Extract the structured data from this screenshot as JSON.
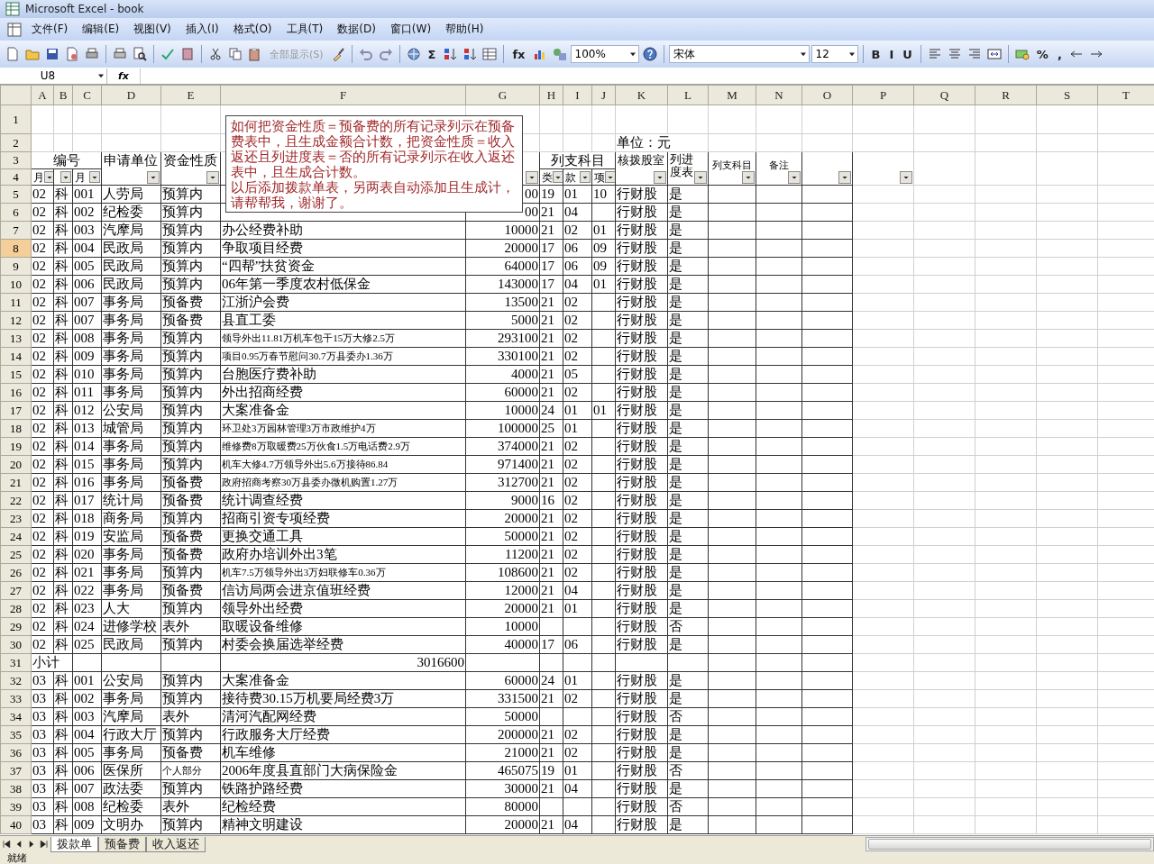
{
  "window": {
    "title": "Microsoft Excel - book"
  },
  "menu": [
    "文件(F)",
    "编辑(E)",
    "视图(V)",
    "插入(I)",
    "格式(O)",
    "工具(T)",
    "数据(D)",
    "窗口(W)",
    "帮助(H)"
  ],
  "toolbar": [
    {
      "kind": "icon"
    },
    {
      "kind": "icon"
    },
    {
      "kind": "icon"
    },
    {
      "kind": "icon"
    },
    {
      "kind": "icon"
    },
    {
      "kind": "sep"
    },
    {
      "kind": "icon"
    },
    {
      "kind": "icon"
    },
    {
      "kind": "sep"
    },
    {
      "kind": "icon"
    },
    {
      "kind": "icon"
    },
    {
      "kind": "sep"
    },
    {
      "kind": "icon"
    },
    {
      "kind": "icon"
    },
    {
      "kind": "icon"
    },
    {
      "kind": "text",
      "label": "全部显示(S)",
      "disabled": true
    },
    {
      "kind": "icon"
    },
    {
      "kind": "sep"
    },
    {
      "kind": "icon"
    },
    {
      "kind": "icon"
    },
    {
      "kind": "sep"
    },
    {
      "kind": "icon"
    },
    {
      "kind": "text",
      "label": "Σ",
      "disabled": false
    },
    {
      "kind": "icon"
    },
    {
      "kind": "icon"
    },
    {
      "kind": "icon"
    },
    {
      "kind": "sep"
    },
    {
      "kind": "text",
      "label": "fx",
      "disabled": false
    },
    {
      "kind": "icon"
    },
    {
      "kind": "icon"
    },
    {
      "kind": "combo",
      "value": "100%"
    },
    {
      "kind": "icon"
    },
    {
      "kind": "sep"
    },
    {
      "kind": "combo",
      "value": "宋体"
    },
    {
      "kind": "combo",
      "value": "12"
    },
    {
      "kind": "sep"
    },
    {
      "kind": "text",
      "label": "B",
      "disabled": false
    },
    {
      "kind": "text",
      "label": "I",
      "disabled": false
    },
    {
      "kind": "text",
      "label": "U",
      "disabled": false
    },
    {
      "kind": "sep"
    },
    {
      "kind": "icon"
    },
    {
      "kind": "icon"
    },
    {
      "kind": "icon"
    },
    {
      "kind": "icon"
    },
    {
      "kind": "sep"
    },
    {
      "kind": "icon"
    },
    {
      "kind": "text",
      "label": "%",
      "disabled": false
    },
    {
      "kind": "text",
      "label": ",",
      "disabled": false
    },
    {
      "kind": "icon"
    },
    {
      "kind": "icon"
    }
  ],
  "formula_bar": {
    "name_box": "U8",
    "fx": "fx"
  },
  "columns": [
    "A",
    "B",
    "C",
    "D",
    "E",
    "F",
    "G",
    "H",
    "I",
    "J",
    "K",
    "L",
    "M",
    "N",
    "O",
    "P",
    "Q",
    "R",
    "S",
    "T"
  ],
  "top_rows": [
    {
      "n": "1",
      "selected": false
    },
    {
      "n": "2",
      "selected": false
    },
    {
      "n": "3",
      "selected": false
    },
    {
      "n": "4",
      "selected": false
    }
  ],
  "unit_note": "单位：元",
  "table_header": [
    {
      "label": "编号",
      "sub": [
        {
          "label": "月",
          "filter": true
        },
        {
          "filter": true
        },
        {
          "label": "月",
          "filter": true
        }
      ]
    },
    {
      "label": "申请单位",
      "filter": true
    },
    {
      "label": "资金性质",
      "filter": true
    },
    {
      "filter": false
    },
    {
      "filter": true
    },
    {
      "label": "列支科目",
      "sub": [
        {
          "label": "类",
          "filter": true
        },
        {
          "label": "款",
          "filter": true
        },
        {
          "label": "项",
          "filter": true
        }
      ]
    },
    {
      "label": "核拨股室",
      "filter": true
    },
    {
      "label": "列进度表",
      "filter": true
    },
    {
      "label": "列支科目",
      "filter": true,
      "small": true
    },
    {
      "label": "备注",
      "filter": true,
      "small": true
    },
    {
      "filter": true
    },
    {
      "filter": true,
      "outside": true
    }
  ],
  "rows": [
    {
      "n": "5",
      "selected": false,
      "cells": [
        "02",
        "科",
        "001",
        "人劳局",
        "预算内",
        "",
        "00",
        "19",
        "01",
        "10",
        "行财股",
        "是"
      ]
    },
    {
      "n": "6",
      "selected": false,
      "cells": [
        "02",
        "科",
        "002",
        "纪检委",
        "预算内",
        "",
        "00",
        "21",
        "04",
        "",
        "行财股",
        "是"
      ]
    },
    {
      "n": "7",
      "selected": false,
      "cells": [
        "02",
        "科",
        "003",
        "汽摩局",
        "预算内",
        "办公经费补助",
        "10000",
        "21",
        "02",
        "01",
        "行财股",
        "是"
      ]
    },
    {
      "n": "8",
      "selected": true,
      "cells": [
        "02",
        "科",
        "004",
        "民政局",
        "预算内",
        "争取项目经费",
        "20000",
        "17",
        "06",
        "09",
        "行财股",
        "是"
      ]
    },
    {
      "n": "9",
      "selected": false,
      "cells": [
        "02",
        "科",
        "005",
        "民政局",
        "预算内",
        "“四帮”扶贫资金",
        "64000",
        "17",
        "06",
        "09",
        "行财股",
        "是"
      ]
    },
    {
      "n": "10",
      "selected": false,
      "cells": [
        "02",
        "科",
        "006",
        "民政局",
        "预算内",
        "06年第一季度农村低保金",
        "143000",
        "17",
        "04",
        "01",
        "行财股",
        "是"
      ]
    },
    {
      "n": "11",
      "selected": false,
      "cells": [
        "02",
        "科",
        "007",
        "事务局",
        "预备费",
        "江浙沪会费",
        "13500",
        "21",
        "02",
        "",
        "行财股",
        "是"
      ]
    },
    {
      "n": "12",
      "selected": false,
      "cells": [
        "02",
        "科",
        "007",
        "事务局",
        "预备费",
        "县直工委",
        "5000",
        "21",
        "02",
        "",
        "行财股",
        "是"
      ]
    },
    {
      "n": "13",
      "selected": false,
      "small": {
        "F": true
      },
      "cells": [
        "02",
        "科",
        "008",
        "事务局",
        "预算内",
        "领导外出11.81万机车包干15万大修2.5万",
        "293100",
        "21",
        "02",
        "",
        "行财股",
        "是"
      ]
    },
    {
      "n": "14",
      "selected": false,
      "small": {
        "F": true
      },
      "cells": [
        "02",
        "科",
        "009",
        "事务局",
        "预算内",
        "项目0.95万春节慰问30.7万县委办1.36万",
        "330100",
        "21",
        "02",
        "",
        "行财股",
        "是"
      ]
    },
    {
      "n": "15",
      "selected": false,
      "cells": [
        "02",
        "科",
        "010",
        "事务局",
        "预算内",
        "台胞医疗费补助",
        "4000",
        "21",
        "05",
        "",
        "行财股",
        "是"
      ]
    },
    {
      "n": "16",
      "selected": false,
      "cells": [
        "02",
        "科",
        "011",
        "事务局",
        "预算内",
        "外出招商经费",
        "60000",
        "21",
        "02",
        "",
        "行财股",
        "是"
      ]
    },
    {
      "n": "17",
      "selected": false,
      "cells": [
        "02",
        "科",
        "012",
        "公安局",
        "预算内",
        "大案准备金",
        "10000",
        "24",
        "01",
        "01",
        "行财股",
        "是"
      ]
    },
    {
      "n": "18",
      "selected": false,
      "small": {
        "F": true
      },
      "cells": [
        "02",
        "科",
        "013",
        "城管局",
        "预算内",
        "环卫处3万园林管理3万市政维护4万",
        "100000",
        "25",
        "01",
        "",
        "行财股",
        "是"
      ]
    },
    {
      "n": "19",
      "selected": false,
      "small": {
        "F": true
      },
      "cells": [
        "02",
        "科",
        "014",
        "事务局",
        "预算内",
        "维修费8万取暖费25万伙食1.5万电话费2.9万",
        "374000",
        "21",
        "02",
        "",
        "行财股",
        "是"
      ]
    },
    {
      "n": "20",
      "selected": false,
      "small": {
        "F": true
      },
      "cells": [
        "02",
        "科",
        "015",
        "事务局",
        "预算内",
        "机车大修4.7万领导外出5.6万接待86.84",
        "971400",
        "21",
        "02",
        "",
        "行财股",
        "是"
      ]
    },
    {
      "n": "21",
      "selected": false,
      "small": {
        "F": true
      },
      "cells": [
        "02",
        "科",
        "016",
        "事务局",
        "预备费",
        "政府招商考察30万县委办微机购置1.27万",
        "312700",
        "21",
        "02",
        "",
        "行财股",
        "是"
      ]
    },
    {
      "n": "22",
      "selected": false,
      "cells": [
        "02",
        "科",
        "017",
        "统计局",
        "预备费",
        "统计调查经费",
        "9000",
        "16",
        "02",
        "",
        "行财股",
        "是"
      ]
    },
    {
      "n": "23",
      "selected": false,
      "cells": [
        "02",
        "科",
        "018",
        "商务局",
        "预算内",
        "招商引资专项经费",
        "20000",
        "21",
        "02",
        "",
        "行财股",
        "是"
      ]
    },
    {
      "n": "24",
      "selected": false,
      "cells": [
        "02",
        "科",
        "019",
        "安监局",
        "预备费",
        "更换交通工具",
        "50000",
        "21",
        "02",
        "",
        "行财股",
        "是"
      ]
    },
    {
      "n": "25",
      "selected": false,
      "cells": [
        "02",
        "科",
        "020",
        "事务局",
        "预备费",
        "政府办培训外出3笔",
        "11200",
        "21",
        "02",
        "",
        "行财股",
        "是"
      ]
    },
    {
      "n": "26",
      "selected": false,
      "small": {
        "F": true
      },
      "cells": [
        "02",
        "科",
        "021",
        "事务局",
        "预算内",
        "机车7.5万领导外出3万妇联修车0.36万",
        "108600",
        "21",
        "02",
        "",
        "行财股",
        "是"
      ]
    },
    {
      "n": "27",
      "selected": false,
      "cells": [
        "02",
        "科",
        "022",
        "事务局",
        "预备费",
        "信访局两会进京值班经费",
        "12000",
        "21",
        "04",
        "",
        "行财股",
        "是"
      ]
    },
    {
      "n": "28",
      "selected": false,
      "cells": [
        "02",
        "科",
        "023",
        "人大",
        "预算内",
        "领导外出经费",
        "20000",
        "21",
        "01",
        "",
        "行财股",
        "是"
      ]
    },
    {
      "n": "29",
      "selected": false,
      "cells": [
        "02",
        "科",
        "024",
        "进修学校",
        "表外",
        "取暖设备维修",
        "10000",
        "",
        "",
        "",
        "行财股",
        "否"
      ]
    },
    {
      "n": "30",
      "selected": false,
      "cells": [
        "02",
        "科",
        "025",
        "民政局",
        "预算内",
        "村委会换届选举经费",
        "40000",
        "17",
        "06",
        "",
        "行财股",
        "是"
      ]
    },
    {
      "n": "31",
      "selected": false,
      "kind": "subtotal",
      "label": "小计",
      "total": "3016600"
    },
    {
      "n": "32",
      "selected": false,
      "cells": [
        "03",
        "科",
        "001",
        "公安局",
        "预算内",
        "大案准备金",
        "60000",
        "24",
        "01",
        "",
        "行财股",
        "是"
      ]
    },
    {
      "n": "33",
      "selected": false,
      "cells": [
        "03",
        "科",
        "002",
        "事务局",
        "预算内",
        "接待费30.15万机要局经费3万",
        "331500",
        "21",
        "02",
        "",
        "行财股",
        "是"
      ]
    },
    {
      "n": "34",
      "selected": false,
      "cells": [
        "03",
        "科",
        "003",
        "汽摩局",
        "表外",
        "清河汽配网经费",
        "50000",
        "",
        "",
        "",
        "行财股",
        "否"
      ]
    },
    {
      "n": "35",
      "selected": false,
      "cells": [
        "03",
        "科",
        "004",
        "行政大厅",
        "预算内",
        "行政服务大厅经费",
        "200000",
        "21",
        "02",
        "",
        "行财股",
        "是"
      ]
    },
    {
      "n": "36",
      "selected": false,
      "cells": [
        "03",
        "科",
        "005",
        "事务局",
        "预备费",
        "机车维修",
        "21000",
        "21",
        "02",
        "",
        "行财股",
        "是"
      ]
    },
    {
      "n": "37",
      "selected": false,
      "small": {
        "E": true
      },
      "cells": [
        "03",
        "科",
        "006",
        "医保所",
        "个人部分",
        "2006年度县直部门大病保险金",
        "465075",
        "19",
        "01",
        "",
        "行财股",
        "否"
      ]
    },
    {
      "n": "38",
      "selected": false,
      "cells": [
        "03",
        "科",
        "007",
        "政法委",
        "预算内",
        "铁路护路经费",
        "30000",
        "21",
        "04",
        "",
        "行财股",
        "是"
      ]
    },
    {
      "n": "39",
      "selected": false,
      "cells": [
        "03",
        "科",
        "008",
        "纪检委",
        "表外",
        "纪检经费",
        "80000",
        "",
        "",
        "",
        "行财股",
        "否"
      ]
    },
    {
      "n": "40",
      "selected": false,
      "cells": [
        "03",
        "科",
        "009",
        "文明办",
        "预算内",
        "精神文明建设",
        "20000",
        "21",
        "04",
        "",
        "行财股",
        "是"
      ]
    }
  ],
  "comment": [
    "如何把资金性质＝预备费的所有记录列示在预备费表中，且生成金额合计数，把资金性质＝收入返还且列进度表＝否的所有记录列示在收入返还表中，且生成合计数。",
    "以后添加拨款单表，另两表自动添加且生成计，请帮帮我，谢谢了。"
  ],
  "sheet_tabs": [
    {
      "label": "拨款单",
      "selected": true
    },
    {
      "label": "预备费",
      "selected": false
    },
    {
      "label": "收入返还",
      "selected": false
    }
  ],
  "status_bar": "就绪"
}
